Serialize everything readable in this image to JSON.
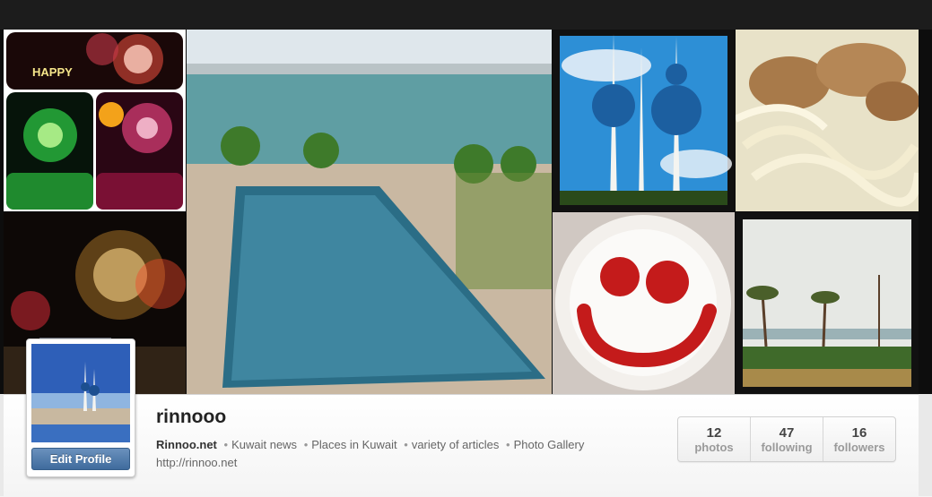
{
  "banner": {
    "tiles": [
      {
        "name": "photo-happy-fireworks-collage"
      },
      {
        "name": "photo-fireworks-night"
      },
      {
        "name": "photo-hotel-pool"
      },
      {
        "name": "photo-kuwait-towers"
      },
      {
        "name": "photo-chicken-pasta"
      },
      {
        "name": "photo-ketchup-smiley"
      },
      {
        "name": "photo-beach-palms"
      }
    ],
    "happy_text": "HAPPY"
  },
  "profile": {
    "username": "rinnooo",
    "bio": {
      "site_name": "Rinnoo.net",
      "separator": "•",
      "items": [
        "Kuwait news",
        "Places in Kuwait",
        "variety of articles",
        "Photo Gallery"
      ]
    },
    "url": "http://rinnoo.net",
    "edit_button_label": "Edit Profile"
  },
  "stats": [
    {
      "value": "12",
      "label": "photos"
    },
    {
      "value": "47",
      "label": "following"
    },
    {
      "value": "16",
      "label": "followers"
    }
  ]
}
